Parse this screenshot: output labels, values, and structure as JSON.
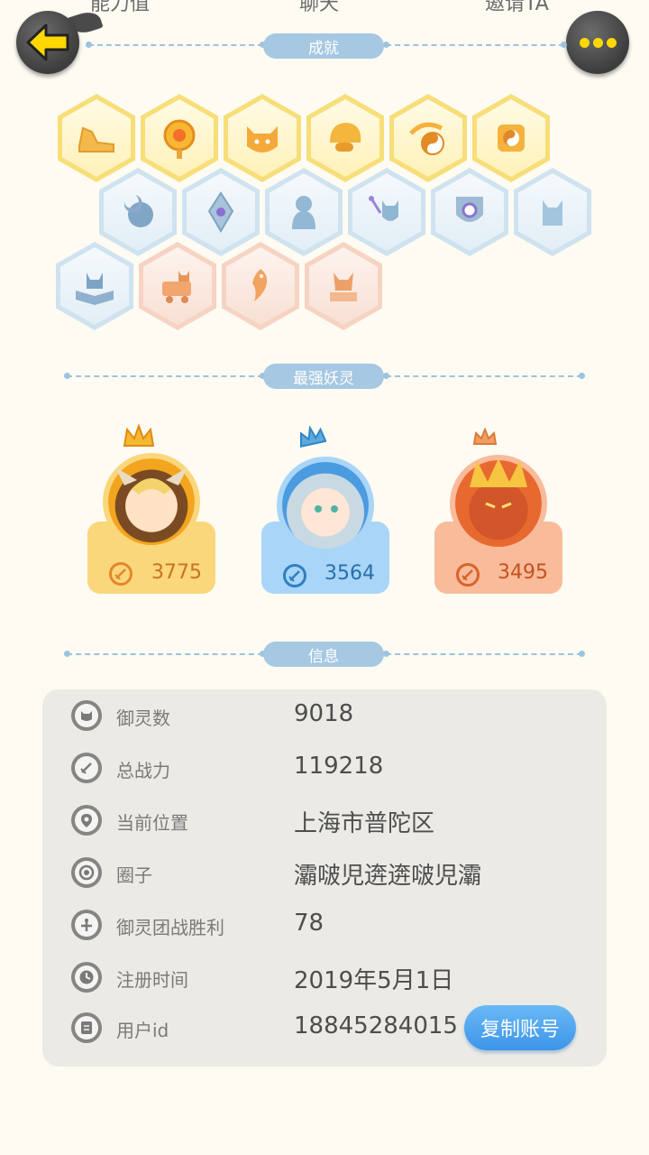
{
  "top_tabs": [
    "能力值",
    "聊天",
    "邀请TA"
  ],
  "sections": {
    "achievements": "成就",
    "strongest": "最强妖灵",
    "info": "信息"
  },
  "achievements": [
    {
      "tier": "gold",
      "icon": "sneaker-icon"
    },
    {
      "tier": "gold",
      "icon": "sun-orb-icon"
    },
    {
      "tier": "gold",
      "icon": "cat-face-icon"
    },
    {
      "tier": "gold",
      "icon": "helmet-icon"
    },
    {
      "tier": "gold",
      "icon": "yinyang-comet-icon"
    },
    {
      "tier": "gold",
      "icon": "yinyang-scroll-icon"
    },
    {
      "tier": "blue",
      "icon": "moon-icon"
    },
    {
      "tier": "blue",
      "icon": "crystal-icon"
    },
    {
      "tier": "blue",
      "icon": "spirit-icon"
    },
    {
      "tier": "blue",
      "icon": "wand-cat-icon"
    },
    {
      "tier": "blue",
      "icon": "shield-icon"
    },
    {
      "tier": "blue",
      "icon": "cat-silhouette-icon"
    },
    {
      "tier": "blue",
      "icon": "book-fox-icon"
    },
    {
      "tier": "peach",
      "icon": "cart-cat-icon"
    },
    {
      "tier": "peach",
      "icon": "koi-fish-icon"
    },
    {
      "tier": "peach",
      "icon": "demon-statue-icon"
    }
  ],
  "spirits": [
    {
      "power": "3775",
      "theme": "gold"
    },
    {
      "power": "3564",
      "theme": "blue"
    },
    {
      "power": "3495",
      "theme": "orange"
    }
  ],
  "info": [
    {
      "icon": "spirit-count-icon",
      "label": "御灵数",
      "value": "9018"
    },
    {
      "icon": "sword-icon",
      "label": "总战力",
      "value": "119218"
    },
    {
      "icon": "location-icon",
      "label": "当前位置",
      "value": "上海市普陀区"
    },
    {
      "icon": "circle-icon",
      "label": "圈子",
      "value": "灞啵児逩逩啵児灞"
    },
    {
      "icon": "sword-hilt-icon",
      "label": "御灵团战胜利",
      "value": "78"
    },
    {
      "icon": "clock-icon",
      "label": "注册时间",
      "value": "2019年5月1日"
    },
    {
      "icon": "id-card-icon",
      "label": "用户id",
      "value": "18845284015"
    }
  ],
  "copy_button": "复制账号",
  "colors": {
    "background": "#fdfbf2",
    "gold_card": "#fbd77c",
    "blue_card": "#a9d5f8",
    "orange_card": "#f9bb9a",
    "accent_yellow": "#ffd800",
    "copy_button": "#4aa3ee"
  }
}
